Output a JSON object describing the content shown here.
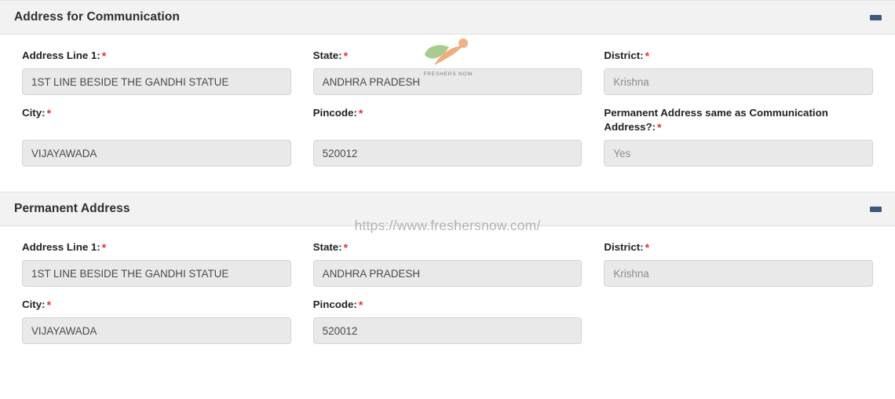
{
  "watermarks": {
    "logo_label": "FRESHERS NOW",
    "url": "https://www.freshersnow.com/",
    "logo_green": "#a9cb8e",
    "logo_orange": "#f0ac7c"
  },
  "theme": {
    "header_bg": "#f2f2f2",
    "input_bg": "#e9e9e9",
    "input_border": "#d4d4d4",
    "required_color": "#e03131",
    "collapse_icon_color": "#3d5a7a",
    "page_bg": "#ffffff"
  },
  "sections": [
    {
      "title": "Address for Communication",
      "collapse_icon": "minus-icon",
      "fields": [
        {
          "label": "Address Line 1:",
          "required": true,
          "value": "1ST LINE BESIDE THE GANDHI STATUE",
          "muted": false,
          "name": "address-line-1"
        },
        {
          "label": "State:",
          "required": true,
          "value": "ANDHRA PRADESH",
          "muted": false,
          "name": "state"
        },
        {
          "label": "District:",
          "required": true,
          "value": "Krishna",
          "muted": true,
          "name": "district"
        },
        {
          "label": "City:",
          "required": true,
          "value": "VIJAYAWADA",
          "muted": false,
          "name": "city"
        },
        {
          "label": "Pincode:",
          "required": true,
          "value": "520012",
          "muted": false,
          "name": "pincode"
        },
        {
          "label": "Permanent Address same as Communication Address?:",
          "required": true,
          "value": "Yes",
          "muted": true,
          "name": "permanent-same-as-communication"
        }
      ]
    },
    {
      "title": "Permanent Address",
      "collapse_icon": "minus-icon",
      "fields": [
        {
          "label": "Address Line 1:",
          "required": true,
          "value": "1ST LINE BESIDE THE GANDHI STATUE",
          "muted": false,
          "name": "permanent-address-line-1"
        },
        {
          "label": "State:",
          "required": true,
          "value": "ANDHRA PRADESH",
          "muted": false,
          "name": "permanent-state"
        },
        {
          "label": "District:",
          "required": true,
          "value": "Krishna",
          "muted": true,
          "name": "permanent-district"
        },
        {
          "label": "City:",
          "required": true,
          "value": "VIJAYAWADA",
          "muted": false,
          "name": "permanent-city"
        },
        {
          "label": "Pincode:",
          "required": true,
          "value": "520012",
          "muted": false,
          "name": "permanent-pincode"
        }
      ]
    }
  ]
}
